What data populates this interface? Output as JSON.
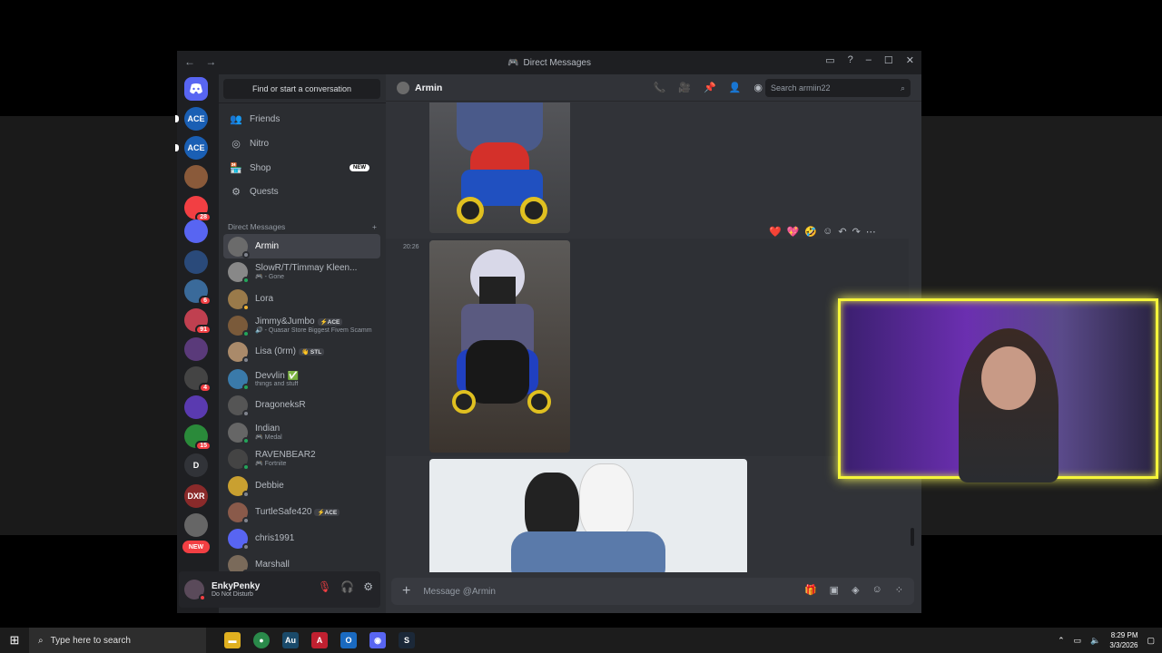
{
  "window": {
    "title": "Direct Messages",
    "back": "←",
    "forward": "→",
    "controls": [
      "▭",
      "?",
      "–",
      "☐",
      "✕"
    ]
  },
  "servers": [
    {
      "label": "ACE",
      "color": "#1a5fb4",
      "badge": ""
    },
    {
      "label": "ACE",
      "color": "#1a5fb4",
      "badge": ""
    },
    {
      "label": "",
      "color": "#8a5a3a",
      "badge": ""
    },
    {
      "label": "",
      "color": "#f23f43",
      "badge": "28"
    },
    {
      "label": "",
      "color": "#5865f2",
      "badge": ""
    },
    {
      "label": "",
      "color": "#2a4a7a",
      "badge": ""
    },
    {
      "label": "",
      "color": "#3a6a9a",
      "badge": "6"
    },
    {
      "label": "",
      "color": "#c04050",
      "badge": "91"
    },
    {
      "label": "",
      "color": "#5a3a7a",
      "badge": ""
    },
    {
      "label": "",
      "color": "#444",
      "badge": "4"
    },
    {
      "label": "",
      "color": "#5a3ab0",
      "badge": ""
    },
    {
      "label": "",
      "color": "#2a8a3a",
      "badge": "15"
    },
    {
      "label": "D",
      "color": "#313338",
      "badge": ""
    },
    {
      "label": "DXR",
      "color": "#8a2a2a",
      "badge": ""
    },
    {
      "label": "",
      "color": "#666",
      "badge": ""
    },
    {
      "label": "NEW",
      "color": "#f23f43",
      "badge": ""
    }
  ],
  "sidebar": {
    "search_label": "Find or start a conversation",
    "nav": [
      {
        "label": "Friends",
        "icon": "👥"
      },
      {
        "label": "Nitro",
        "icon": "◎"
      },
      {
        "label": "Shop",
        "icon": "🏪",
        "badge": "NEW"
      },
      {
        "label": "Quests",
        "icon": "⚙"
      }
    ],
    "dm_header": "Direct Messages",
    "dm_add": "+",
    "dms": [
      {
        "name": "Armin",
        "sub": "",
        "tag": "",
        "color": "#6b6b6b",
        "status": "#80848e",
        "active": true
      },
      {
        "name": "SlowR/T/Timmay Kleen...",
        "sub": "🎮 - Gone",
        "tag": "",
        "color": "#888",
        "status": "#23a55a",
        "active": false
      },
      {
        "name": "Lora",
        "sub": "",
        "tag": "",
        "color": "#9a7a4a",
        "status": "#f0b232",
        "active": false
      },
      {
        "name": "Jimmy&Jumbo",
        "sub": "🔊 - Quasar Store Biggest Fivem Scamm",
        "tag": "⚡ACE",
        "color": "#7a5a3a",
        "status": "#23a55a",
        "active": false
      },
      {
        "name": "Lisa (0rm)",
        "sub": "",
        "tag": "👋 STL",
        "color": "#aa8a6a",
        "status": "#80848e",
        "active": false
      },
      {
        "name": "Devvlin ✅",
        "sub": "things and stuff",
        "tag": "",
        "color": "#3a7aaa",
        "status": "#23a55a",
        "active": false
      },
      {
        "name": "DragoneksR",
        "sub": "",
        "tag": "",
        "color": "#555",
        "status": "#80848e",
        "active": false
      },
      {
        "name": "Indian",
        "sub": "🎮 Medal",
        "tag": "",
        "color": "#666",
        "status": "#23a55a",
        "active": false
      },
      {
        "name": "RAVENBEAR2",
        "sub": "🎮 Fortnite",
        "tag": "",
        "color": "#444",
        "status": "#23a55a",
        "active": false
      },
      {
        "name": "Debbie",
        "sub": "",
        "tag": "",
        "color": "#c9a030",
        "status": "#80848e",
        "active": false
      },
      {
        "name": "TurtleSafe420",
        "sub": "",
        "tag": "⚡ACE",
        "color": "#8a5a4a",
        "status": "#80848e",
        "active": false
      },
      {
        "name": "chris1991",
        "sub": "",
        "tag": "",
        "color": "#5865f2",
        "status": "#80848e",
        "active": false
      },
      {
        "name": "Marshall",
        "sub": "",
        "tag": "",
        "color": "#7a6a5a",
        "status": "#80848e",
        "active": false
      }
    ]
  },
  "user": {
    "name": "EnkyPenky",
    "status": "Do Not Disturb",
    "mic_icon": "mic-muted-icon",
    "headset_icon": "headset-muted-icon",
    "settings_icon": "⚙"
  },
  "chat": {
    "recipient": "Armin",
    "search_placeholder": "Search armiin22",
    "timestamp": "20:26",
    "composer_placeholder": "Message @Armin",
    "reactions": [
      "❤️",
      "💖",
      "🤣"
    ]
  },
  "taskbar": {
    "search": "Type here to search",
    "time": "8:29 PM",
    "date": "3/3/2026"
  }
}
